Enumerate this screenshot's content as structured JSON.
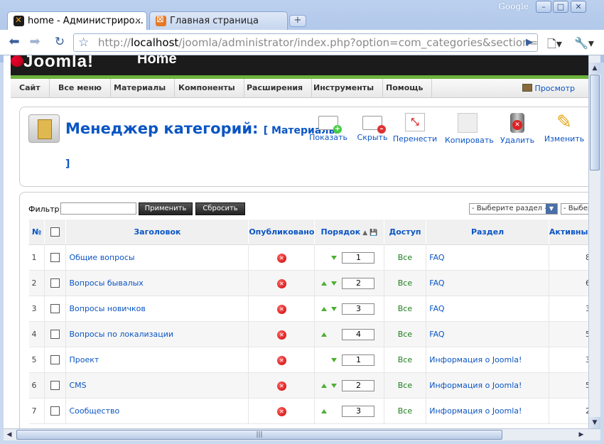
{
  "browser": {
    "google_label": "Google",
    "tabs": [
      {
        "title": "home - Администриро...",
        "close": "✕"
      },
      {
        "title": "Главная страница",
        "close": "✕"
      }
    ],
    "new_tab": "+",
    "url_host": "localhost",
    "url_prefix": "http://",
    "url_rest": "/joomla/administrator/index.php?option=com_categories&section=com_"
  },
  "header": {
    "logo_text": "Joomla!",
    "title": "Home"
  },
  "menu": {
    "items": [
      "Сайт",
      "Все меню",
      "Материалы",
      "Компоненты",
      "Расширения",
      "Инструменты",
      "Помощь"
    ],
    "preview": "Просмотр"
  },
  "toolbar": {
    "title": "Менеджер категорий:",
    "subtitle": "[ Материалы",
    "subtitle_close": "]",
    "buttons": {
      "show": "Показать",
      "hide": "Скрыть",
      "move": "Перенести",
      "copy": "Копировать",
      "delete": "Удалить",
      "edit": "Изменить"
    }
  },
  "filter": {
    "label": "Фильтр:",
    "value": "",
    "apply": "Применить",
    "reset": "Сбросить",
    "section_select": "- Выберите раздел -",
    "second_select": "- Выбер"
  },
  "table": {
    "headers": {
      "num": "№",
      "title": "Заголовок",
      "published": "Опубликовано",
      "order": "Порядок",
      "access": "Доступ",
      "section": "Раздел",
      "active": "Активные"
    },
    "rows": [
      {
        "num": "1",
        "title": "Общие вопросы",
        "up": false,
        "down": true,
        "order": "1",
        "access": "Все",
        "section": "FAQ",
        "count": "8"
      },
      {
        "num": "2",
        "title": "Вопросы бывалых",
        "up": true,
        "down": true,
        "order": "2",
        "access": "Все",
        "section": "FAQ",
        "count": "6"
      },
      {
        "num": "3",
        "title": "Вопросы новичков",
        "up": true,
        "down": true,
        "order": "3",
        "access": "Все",
        "section": "FAQ",
        "count": "3"
      },
      {
        "num": "4",
        "title": "Вопросы по локализации",
        "up": true,
        "down": false,
        "order": "4",
        "access": "Все",
        "section": "FAQ",
        "count": "5"
      },
      {
        "num": "5",
        "title": "Проект",
        "up": false,
        "down": true,
        "order": "1",
        "access": "Все",
        "section": "Информация о Joomla!",
        "count": "3"
      },
      {
        "num": "6",
        "title": "CMS",
        "up": true,
        "down": true,
        "order": "2",
        "access": "Все",
        "section": "Информация о Joomla!",
        "count": "5"
      },
      {
        "num": "7",
        "title": "Сообщество",
        "up": true,
        "down": false,
        "order": "3",
        "access": "Все",
        "section": "Информация о Joomla!",
        "count": "2"
      }
    ]
  },
  "colors": {
    "link": "#0b55c4",
    "access_green": "#1b7f1b",
    "header_bar": "#1b1b1b",
    "accent_green": "#6cb33e"
  }
}
